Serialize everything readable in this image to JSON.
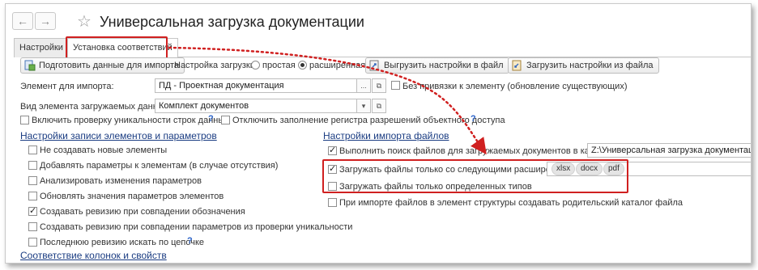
{
  "window": {
    "title": "Универсальная загрузка документации"
  },
  "nav": {
    "back": "←",
    "forward": "→",
    "star": "☆"
  },
  "tabs": [
    "Настройки",
    "Установка соответствий"
  ],
  "toolbar": {
    "prepare_label": "Подготовить данные для импорта",
    "load_setting_label": "Настройка загрузки:",
    "radio_simple": "простая",
    "radio_extended": "расширенная",
    "export_settings": "Выгрузить настройки в файл",
    "import_settings": "Загрузить настройки из файла"
  },
  "form": {
    "element_label": "Элемент для импорта:",
    "element_value": "ПД - Проектная документация",
    "no_binding_label": "Без привязки к элементу (обновление существующих)",
    "kind_label": "Вид элемента загружаемых данных:",
    "kind_value": "Комплект документов",
    "uniq_check": "Включить проверку уникальности строк данных",
    "disable_register": "Отключить заполнение регистра разрешений объектного доступа",
    "help": "?",
    "dots": "...",
    "open": "⧉",
    "dropdown": "▾"
  },
  "left_section": {
    "title": "Настройки записи элементов и параметров",
    "items": [
      {
        "label": "Не создавать новые элементы",
        "checked": false
      },
      {
        "label": "Добавлять параметры к элементам (в случае отсутствия)",
        "checked": false
      },
      {
        "label": "Анализировать изменения параметров",
        "checked": false
      },
      {
        "label": "Обновлять значения параметров элементов",
        "checked": false
      },
      {
        "label": "Создавать ревизию при совпадении обозначения",
        "checked": true
      },
      {
        "label": "Создавать ревизию при совпадении параметров из проверки уникальности",
        "checked": false
      },
      {
        "label": "Последнюю ревизию искать по цепочке",
        "checked": false
      }
    ],
    "help": "?",
    "bottom_title": "Соответствие колонок и свойств"
  },
  "right_section": {
    "title": "Настройки импорта файлов",
    "search_label": "Выполнить поиск файлов для загружаемых документов в каталоге",
    "search_path": "Z:\\Универсальная загрузка документации\\",
    "ext_label": "Загружать файлы только со следующими расширениями",
    "extensions": [
      "xlsx",
      "docx",
      "pdf"
    ],
    "types_label": "Загружать файлы только определенных типов",
    "parent_label": "При импорте файлов в элемент структуры создавать родительский каталог файла"
  },
  "colors": {
    "accent_red": "#d02020",
    "link_blue": "#1a3c82",
    "help_blue": "#2a62c8"
  }
}
